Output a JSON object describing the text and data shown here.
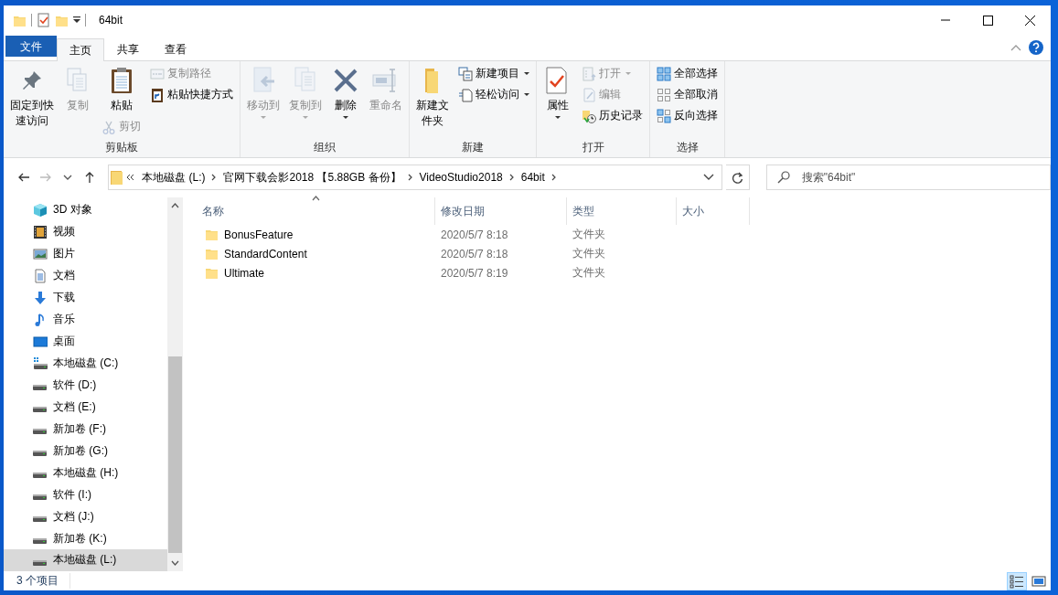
{
  "window": {
    "title": "64bit"
  },
  "ribbon_tabs": [
    {
      "label": "文件",
      "kind": "file",
      "selected": false
    },
    {
      "label": "主页",
      "kind": "tab",
      "selected": true
    },
    {
      "label": "共享",
      "kind": "tab",
      "selected": false
    },
    {
      "label": "查看",
      "kind": "tab",
      "selected": false
    }
  ],
  "ribbon_groups": [
    {
      "label": "剪贴板",
      "columns": [
        [
          {
            "label": "固定到快速访问",
            "kind": "large",
            "disabled": false,
            "dropdown": false
          }
        ],
        [
          {
            "label": "复制",
            "kind": "large",
            "disabled": true,
            "dropdown": false
          }
        ],
        [
          {
            "label": "粘贴",
            "kind": "large",
            "disabled": false,
            "dropdown": false
          },
          {
            "label": "剪切",
            "kind": "small",
            "disabled": true,
            "dropdown": false
          }
        ],
        [
          {
            "label": "复制路径",
            "kind": "small",
            "disabled": true,
            "dropdown": false
          },
          {
            "label": "粘贴快捷方式",
            "kind": "small",
            "disabled": false,
            "dropdown": false
          }
        ]
      ]
    },
    {
      "label": "组织",
      "columns": [
        [
          {
            "label": "移动到",
            "kind": "large",
            "disabled": true,
            "dropdown": true
          }
        ],
        [
          {
            "label": "复制到",
            "kind": "large",
            "disabled": true,
            "dropdown": true
          }
        ],
        [
          {
            "label": "删除",
            "kind": "large",
            "disabled": false,
            "dropdown": true
          }
        ],
        [
          {
            "label": "重命名",
            "kind": "large",
            "disabled": true,
            "dropdown": false
          }
        ]
      ]
    },
    {
      "label": "新建",
      "columns": [
        [
          {
            "label": "新建文件夹",
            "kind": "large",
            "disabled": false,
            "dropdown": false
          }
        ],
        [
          {
            "label": "新建项目",
            "kind": "small",
            "disabled": false,
            "dropdown": true
          },
          {
            "label": "轻松访问",
            "kind": "small",
            "disabled": false,
            "dropdown": true
          }
        ]
      ]
    },
    {
      "label": "打开",
      "columns": [
        [
          {
            "label": "属性",
            "kind": "large",
            "disabled": false,
            "dropdown": true
          }
        ],
        [
          {
            "label": "打开",
            "kind": "small",
            "disabled": true,
            "dropdown": true
          },
          {
            "label": "编辑",
            "kind": "small",
            "disabled": true,
            "dropdown": false
          },
          {
            "label": "历史记录",
            "kind": "small",
            "disabled": false,
            "dropdown": false
          }
        ]
      ]
    },
    {
      "label": "选择",
      "columns": [
        [
          {
            "label": "全部选择",
            "kind": "small",
            "disabled": false,
            "dropdown": false
          },
          {
            "label": "全部取消",
            "kind": "small",
            "disabled": false,
            "dropdown": false
          },
          {
            "label": "反向选择",
            "kind": "small",
            "disabled": false,
            "dropdown": false
          }
        ]
      ]
    }
  ],
  "address_bar": {
    "segments": [
      "本地磁盘 (L:)",
      "官网下载会影2018 【5.88GB 备份】",
      "VideoStudio2018",
      "64bit"
    ]
  },
  "search": {
    "placeholder": "搜索\"64bit\""
  },
  "sidebar": {
    "items": [
      {
        "label": "3D 对象",
        "kind": "objects",
        "selected": false
      },
      {
        "label": "视频",
        "kind": "video",
        "selected": false
      },
      {
        "label": "图片",
        "kind": "pictures",
        "selected": false
      },
      {
        "label": "文档",
        "kind": "documents",
        "selected": false
      },
      {
        "label": "下载",
        "kind": "downloads",
        "selected": false
      },
      {
        "label": "音乐",
        "kind": "music",
        "selected": false
      },
      {
        "label": "桌面",
        "kind": "desktop",
        "selected": false
      },
      {
        "label": "本地磁盘 (C:)",
        "kind": "system",
        "selected": false
      },
      {
        "label": "软件 (D:)",
        "kind": "drive",
        "selected": false
      },
      {
        "label": "文档 (E:)",
        "kind": "drive",
        "selected": false
      },
      {
        "label": "新加卷 (F:)",
        "kind": "drive",
        "selected": false
      },
      {
        "label": "新加卷 (G:)",
        "kind": "drive",
        "selected": false
      },
      {
        "label": "本地磁盘 (H:)",
        "kind": "drive",
        "selected": false
      },
      {
        "label": "软件 (I:)",
        "kind": "drive",
        "selected": false
      },
      {
        "label": "文档 (J:)",
        "kind": "drive",
        "selected": false
      },
      {
        "label": "新加卷 (K:)",
        "kind": "drive",
        "selected": false
      },
      {
        "label": "本地磁盘 (L:)",
        "kind": "drive",
        "selected": true
      }
    ]
  },
  "table": {
    "columns": [
      "名称",
      "修改日期",
      "类型",
      "大小"
    ],
    "rows": [
      {
        "name": "BonusFeature",
        "modified": "2020/5/7 8:18",
        "type": "文件夹"
      },
      {
        "name": "StandardContent",
        "modified": "2020/5/7 8:18",
        "type": "文件夹"
      },
      {
        "name": "Ultimate",
        "modified": "2020/5/7 8:19",
        "type": "文件夹"
      }
    ]
  },
  "status_bar": {
    "text": "3 个项目",
    "views": [
      {
        "kind": "details",
        "selected": true
      },
      {
        "kind": "icons",
        "selected": false
      }
    ]
  }
}
